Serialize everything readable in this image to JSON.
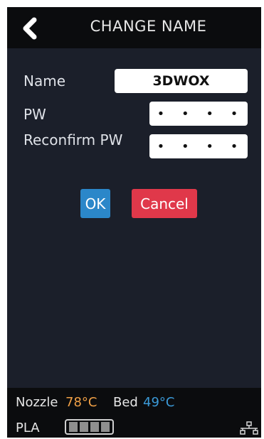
{
  "header": {
    "title": "CHANGE NAME",
    "back_icon": "chevron-left-icon"
  },
  "form": {
    "name_label": "Name",
    "name_value": "3DWOX",
    "pw_label": "PW",
    "pw_value": "• • • •",
    "reconfirm_label": "Reconfirm PW",
    "reconfirm_value": "• • • •"
  },
  "buttons": {
    "ok_label": "OK",
    "cancel_label": "Cancel"
  },
  "status": {
    "nozzle_label": "Nozzle",
    "nozzle_temp": "78°C",
    "bed_label": "Bed",
    "bed_temp": "49°C",
    "material": "PLA",
    "filament_level": 1.0,
    "network_icon": "network-icon"
  },
  "colors": {
    "nozzle_temp": "#f0a046",
    "bed_temp": "#3b9ad8",
    "ok_button": "#2b87c9",
    "cancel_button": "#e0384a"
  }
}
